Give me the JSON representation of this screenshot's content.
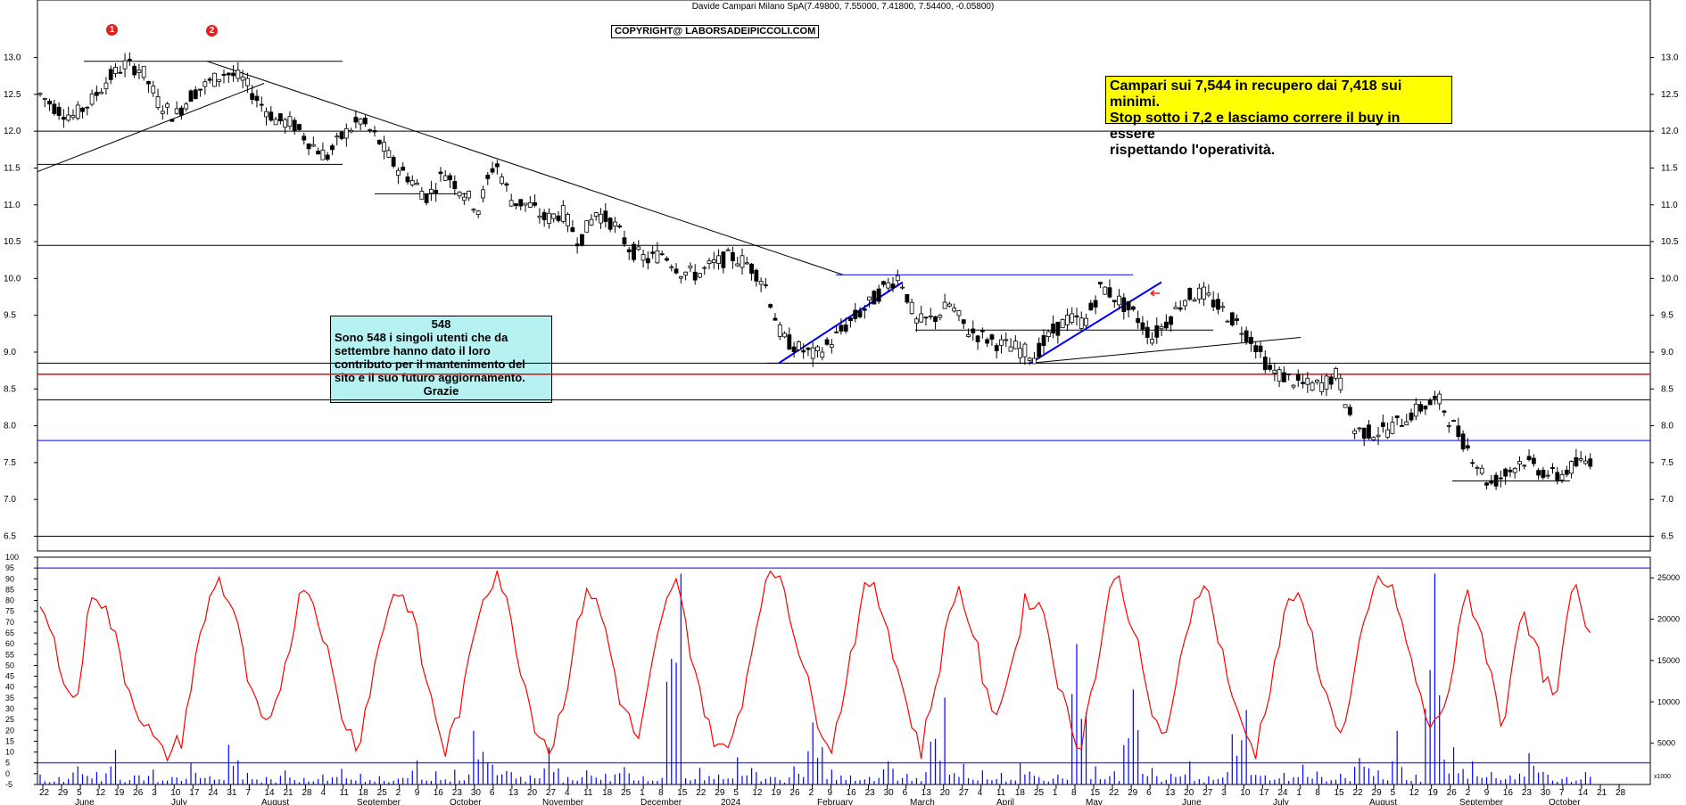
{
  "header": {
    "title": "Davide Campari Milano SpA",
    "ohlc": "(7.49800, 7.55000, 7.41800, 7.54400, -0.05800)"
  },
  "copyright": "COPYRIGHT@ LABORSADEIPICCOLI.COM",
  "markers": [
    "1",
    "2"
  ],
  "note_yellow": {
    "text": "Campari sui 7,544 in recupero dai 7,418 sui minimi.\nStop sotto i 7,2 e lasciamo correre il buy in essere\nrispettando l'operatività."
  },
  "note_cyan": {
    "count": "548",
    "body": "Sono 548 i singoli utenti che da settembre hanno dato il loro contributo per il mantenimento del sito e il suo futuro aggiornamento.",
    "thanks": "Grazie"
  },
  "colors": {
    "candle": "#000000",
    "support_red": "#ff0000",
    "channel_blue": "#0000ff",
    "oscillator": "#ff0000",
    "volume": "#0000ff",
    "note_yellow": "#ffff00",
    "note_cyan": "#b6f2f2"
  },
  "chart_data": [
    {
      "type": "candlestick",
      "title": "Davide Campari Milano SpA",
      "ylim": [
        6.3,
        13.6
      ],
      "yticks": [
        "13.0",
        "12.5",
        "12.0",
        "11.5",
        "11.0",
        "10.5",
        "10.0",
        "9.5",
        "9.0",
        "8.5",
        "8.0",
        "7.5",
        "7.0",
        "6.5"
      ],
      "x_day_ticks": [
        "22",
        "29",
        "5",
        "12",
        "19",
        "26",
        "3",
        "10",
        "17",
        "24",
        "31",
        "7",
        "14",
        "21",
        "28",
        "4",
        "11",
        "18",
        "25",
        "2",
        "9",
        "16",
        "23",
        "30",
        "6",
        "13",
        "20",
        "27",
        "4",
        "11",
        "18",
        "25",
        "1",
        "8",
        "15",
        "22",
        "29",
        "5",
        "12",
        "19",
        "26",
        "2",
        "9",
        "16",
        "23",
        "30",
        "6",
        "13",
        "20",
        "27",
        "4",
        "11",
        "18",
        "25",
        "1",
        "8",
        "15",
        "22",
        "29",
        "6",
        "13",
        "20",
        "27",
        "3",
        "10",
        "17",
        "24",
        "1",
        "8",
        "15",
        "22",
        "29",
        "5",
        "12",
        "19",
        "26",
        "2",
        "9",
        "16",
        "23",
        "30",
        "7",
        "14",
        "21",
        "28"
      ],
      "x_month_labels": [
        "June",
        "July",
        "August",
        "September",
        "October",
        "November",
        "December",
        "2024",
        "February",
        "March",
        "April",
        "May",
        "June",
        "July",
        "August",
        "September",
        "October"
      ],
      "close_path": [
        12.5,
        12.3,
        12.2,
        12.4,
        12.7,
        12.9,
        12.85,
        12.4,
        12.2,
        12.5,
        12.65,
        12.8,
        12.7,
        12.4,
        12.15,
        12.1,
        11.85,
        11.65,
        11.95,
        12.15,
        11.9,
        11.55,
        11.35,
        11.1,
        11.45,
        11.2,
        10.95,
        11.6,
        11.05,
        11.0,
        10.8,
        10.9,
        10.5,
        10.9,
        10.75,
        10.4,
        10.25,
        10.35,
        10.1,
        10.05,
        10.2,
        10.3,
        10.2,
        9.95,
        9.2,
        9.05,
        8.95,
        9.15,
        9.4,
        9.6,
        9.85,
        10.05,
        9.4,
        9.45,
        9.65,
        9.3,
        9.2,
        9.1,
        9.05,
        8.95,
        9.25,
        9.45,
        9.4,
        9.9,
        9.7,
        9.5,
        9.2,
        9.45,
        9.75,
        9.8,
        9.6,
        9.4,
        9.15,
        8.75,
        8.65,
        8.55,
        8.55,
        8.7,
        7.95,
        7.9,
        7.95,
        8.1,
        8.25,
        8.35,
        7.95,
        7.6,
        7.2,
        7.35,
        7.55,
        7.4,
        7.3,
        7.45,
        7.54
      ],
      "horizontal_levels": [
        12.0,
        11.55,
        11.15,
        10.45,
        10.05,
        9.3,
        8.85,
        8.7,
        8.35,
        7.8,
        7.25,
        6.5
      ],
      "red_support": 8.7,
      "blue_levels": [
        10.05,
        7.8
      ]
    },
    {
      "type": "line",
      "name": "oscillator",
      "ylim": [
        -5,
        100
      ],
      "yticks": [
        "100",
        "95",
        "90",
        "85",
        "80",
        "75",
        "70",
        "65",
        "60",
        "55",
        "50",
        "45",
        "40",
        "35",
        "30",
        "25",
        "20",
        "15",
        "10",
        "5",
        "0",
        "-5"
      ],
      "values": [
        78,
        55,
        30,
        88,
        70,
        40,
        22,
        8,
        15,
        60,
        92,
        75,
        35,
        18,
        55,
        90,
        68,
        30,
        12,
        50,
        85,
        78,
        40,
        10,
        35,
        80,
        95,
        60,
        25,
        10,
        45,
        88,
        70,
        32,
        15,
        60,
        92,
        55,
        20,
        8,
        40,
        85,
        94,
        60,
        28,
        12,
        55,
        90,
        72,
        38,
        10,
        48,
        88,
        65,
        25,
        45,
        82,
        75,
        35,
        12,
        50,
        95,
        70,
        30,
        15,
        65,
        92,
        60,
        25,
        10,
        48,
        85,
        70,
        35,
        18,
        62,
        92,
        80,
        45,
        18,
        40,
        85,
        60,
        20,
        75,
        55,
        30,
        88,
        65
      ]
    },
    {
      "type": "bar",
      "name": "volume",
      "ylim": [
        0,
        27500
      ],
      "yticks": [
        "25000",
        "20000",
        "15000",
        "10000",
        "5000"
      ],
      "values": [
        1200,
        900,
        2200,
        1500,
        4200,
        1100,
        1800,
        900,
        1300,
        2600,
        1000,
        4800,
        1400,
        900,
        1700,
        800,
        1200,
        1900,
        1300,
        1000,
        700,
        2900,
        1600,
        900,
        1800,
        6500,
        2400,
        1500,
        1100,
        4500,
        900,
        1700,
        1300,
        2100,
        1000,
        800,
        25500,
        2000,
        1600,
        1200,
        3300,
        1500,
        900,
        2200,
        7500,
        1800,
        1100,
        900,
        2800,
        1300,
        1500,
        10500,
        2500,
        1700,
        1000,
        1400,
        2600,
        900,
        1200,
        17000,
        2200,
        1600,
        11500,
        2000,
        1300,
        2800,
        1000,
        1500,
        9000,
        1800,
        1100,
        1400,
        2400,
        900,
        1300,
        3200,
        1700,
        6500,
        1200,
        25500,
        4500,
        2800,
        1500,
        1100,
        2000,
        3800,
        1200,
        900,
        1500
      ]
    },
    {
      "type": "table",
      "name": "volume-scale-unit",
      "text": "x1000"
    }
  ]
}
